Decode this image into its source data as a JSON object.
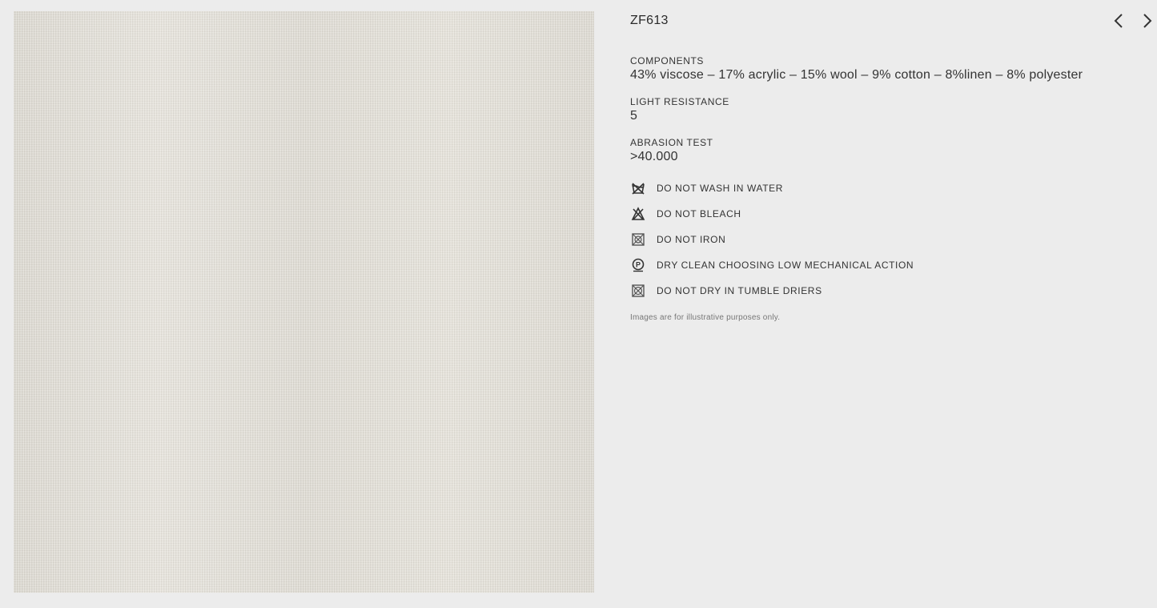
{
  "product": {
    "code": "ZF613"
  },
  "specs": {
    "components": {
      "label": "COMPONENTS",
      "value": "43% viscose – 17% acrylic – 15% wool – 9% cotton – 8%linen – 8% polyester"
    },
    "light_resistance": {
      "label": "LIGHT RESISTANCE",
      "value": "5"
    },
    "abrasion_test": {
      "label": "ABRASION TEST",
      "value": ">40.000"
    }
  },
  "care": [
    {
      "icon": "no-wash-icon",
      "label": "DO NOT WASH IN WATER"
    },
    {
      "icon": "no-bleach-icon",
      "label": "DO NOT BLEACH"
    },
    {
      "icon": "no-iron-icon",
      "label": "DO NOT IRON"
    },
    {
      "icon": "dry-clean-p-icon",
      "label": "DRY CLEAN CHOOSING LOW MECHANICAL ACTION"
    },
    {
      "icon": "no-tumble-dry-icon",
      "label": "DO NOT DRY IN TUMBLE DRIERS"
    }
  ],
  "disclaimer": "Images are for illustrative purposes only.",
  "nav": {
    "prev_icon": "chevron-left-icon",
    "next_icon": "chevron-right-icon"
  },
  "colors": {
    "background": "#ececec",
    "fabric": "#e2dfd8",
    "text": "#2a2a2a"
  }
}
